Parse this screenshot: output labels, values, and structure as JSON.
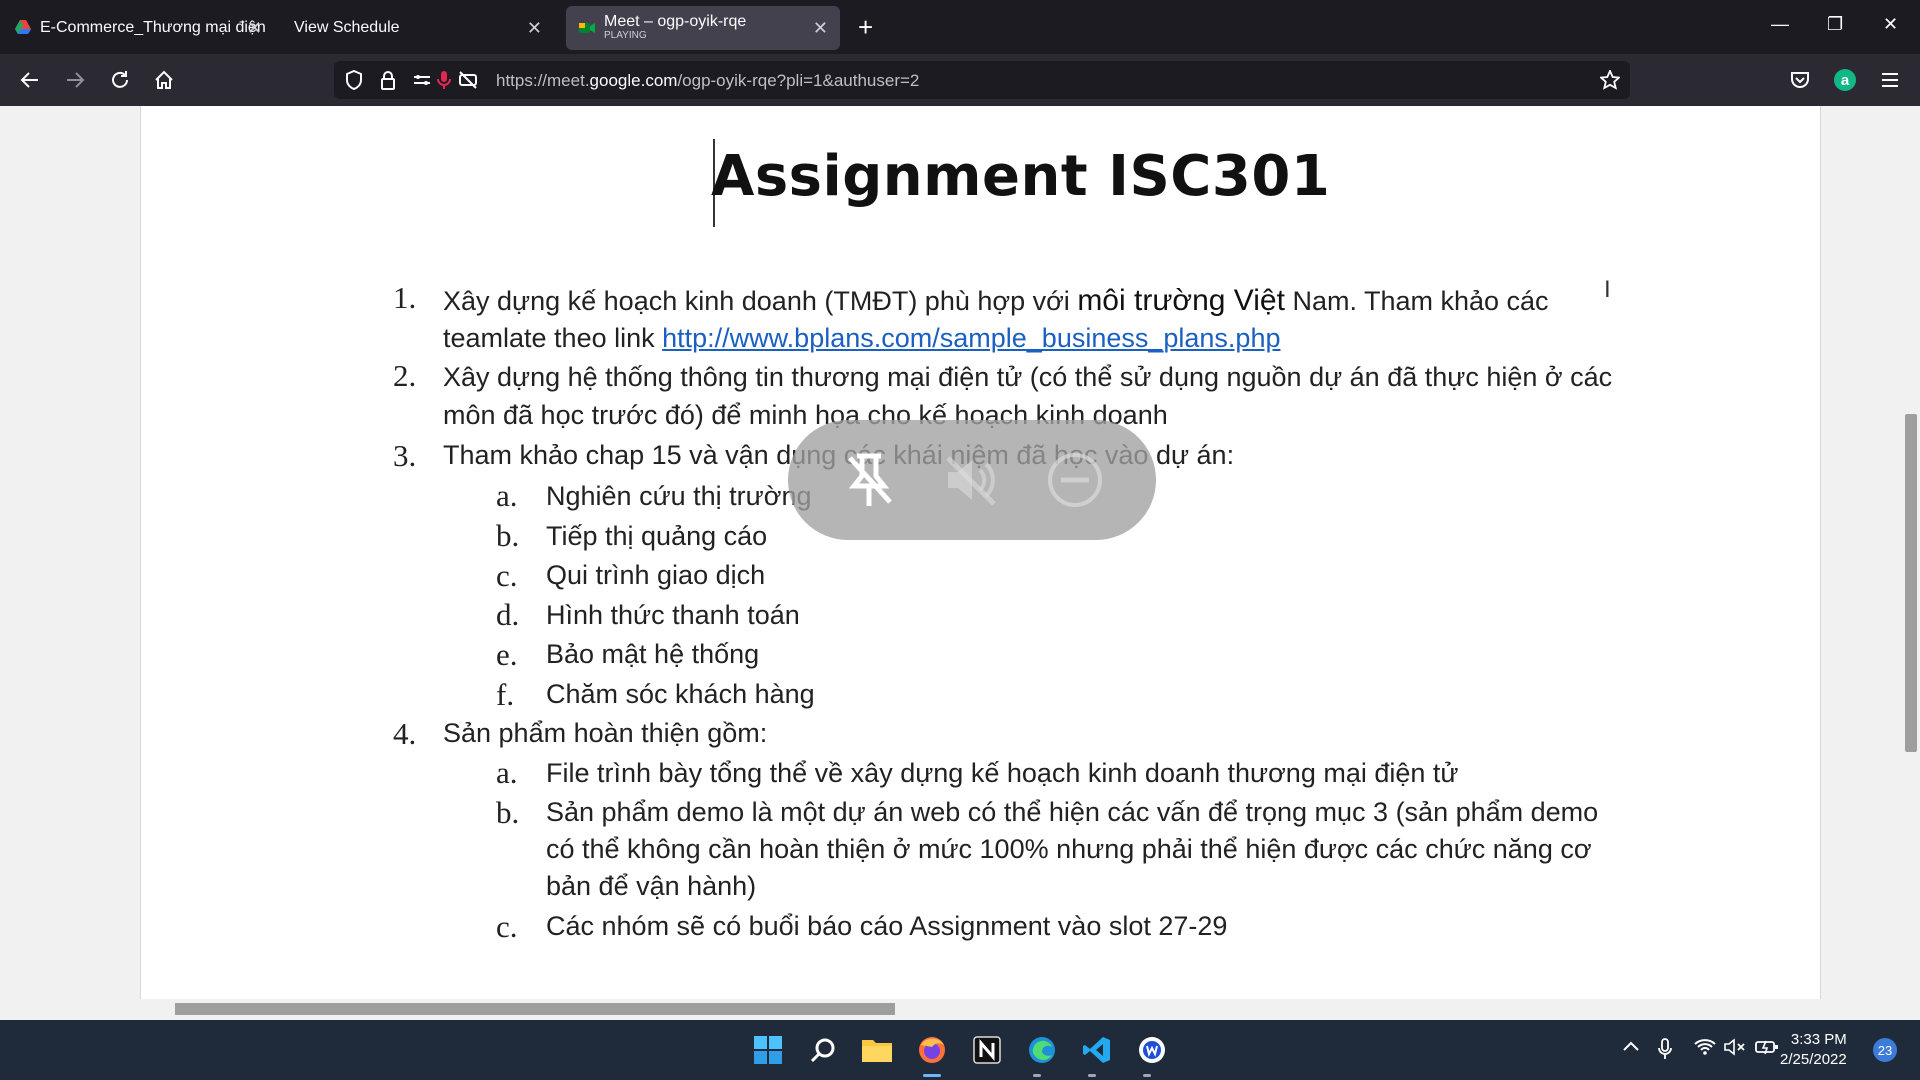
{
  "browser": {
    "tabs": [
      {
        "title": "E-Commerce_Thương mại điện",
        "subtitle": ""
      },
      {
        "title": "View Schedule",
        "subtitle": ""
      },
      {
        "title": "Meet – ogp-oyik-rqe",
        "subtitle": "PLAYING"
      }
    ],
    "url_prefix": "https://meet.",
    "url_domain": "google.com",
    "url_path": "/ogp-oyik-rqe?pli=1&authuser=2",
    "account_initial": "a"
  },
  "document": {
    "title": "Assignment ISC301",
    "items": [
      {
        "num": "1.",
        "line1_a": "Xây dựng kế hoạch kinh doanh  (TMĐT) phù hợp với ",
        "line1_b": "môi trường Việt",
        "line1_c": " Nam. Tham khảo các",
        "line2": "teamlate theo link  ",
        "link": "http://www.bplans.com/sample_business_plans.php"
      },
      {
        "num": "2.",
        "line1": "Xây dựng hệ thống thông tin thương mại điện tử (có thể sử dụng nguồn dự án đã thực hiện ở các",
        "line2": "môn đã học trước đó) để minh họa cho kế hoạch kinh doanh"
      },
      {
        "num": "3.",
        "line1": "Tham khảo chap 15 và vận dụng các khái niệm đã học vào dự án:",
        "sub": [
          {
            "letter": "a.",
            "text": "Nghiên cứu thị trường"
          },
          {
            "letter": "b.",
            "text": "Tiếp thị quảng cáo"
          },
          {
            "letter": "c.",
            "text": "Qui trình giao dịch"
          },
          {
            "letter": "d.",
            "text": "Hình thức thanh toán"
          },
          {
            "letter": "e.",
            "text": "Bảo mật hệ thống"
          },
          {
            "letter": "f.",
            "text": "Chăm sóc khách hàng"
          }
        ]
      },
      {
        "num": "4.",
        "line1": "Sản phẩm hoàn thiện gồm:",
        "sub": [
          {
            "letter": "a.",
            "text": "File trình bày tổng thể về xây dựng kế hoạch kinh doanh thương mại điện tử"
          },
          {
            "letter": "b.",
            "text": "Sản phẩm demo là một dự án web có thể hiện các vấn để trọng mục 3 (sản phẩm demo",
            "text2": "có thể không cần hoàn thiện ở mức 100% nhưng phải thể hiện được các chức năng cơ",
            "text3": "bản để vận hành)"
          },
          {
            "letter": "c.",
            "text": "Các nhóm sẽ có buổi báo cáo Assignment vào slot 27-29"
          }
        ]
      }
    ]
  },
  "taskbar": {
    "time": "3:33 PM",
    "date": "2/25/2022",
    "notifications": "23"
  },
  "colors": {
    "accent": "#1a5fc2",
    "chrome_dark": "#1c1b22",
    "taskbar": "#1f2b3a"
  }
}
